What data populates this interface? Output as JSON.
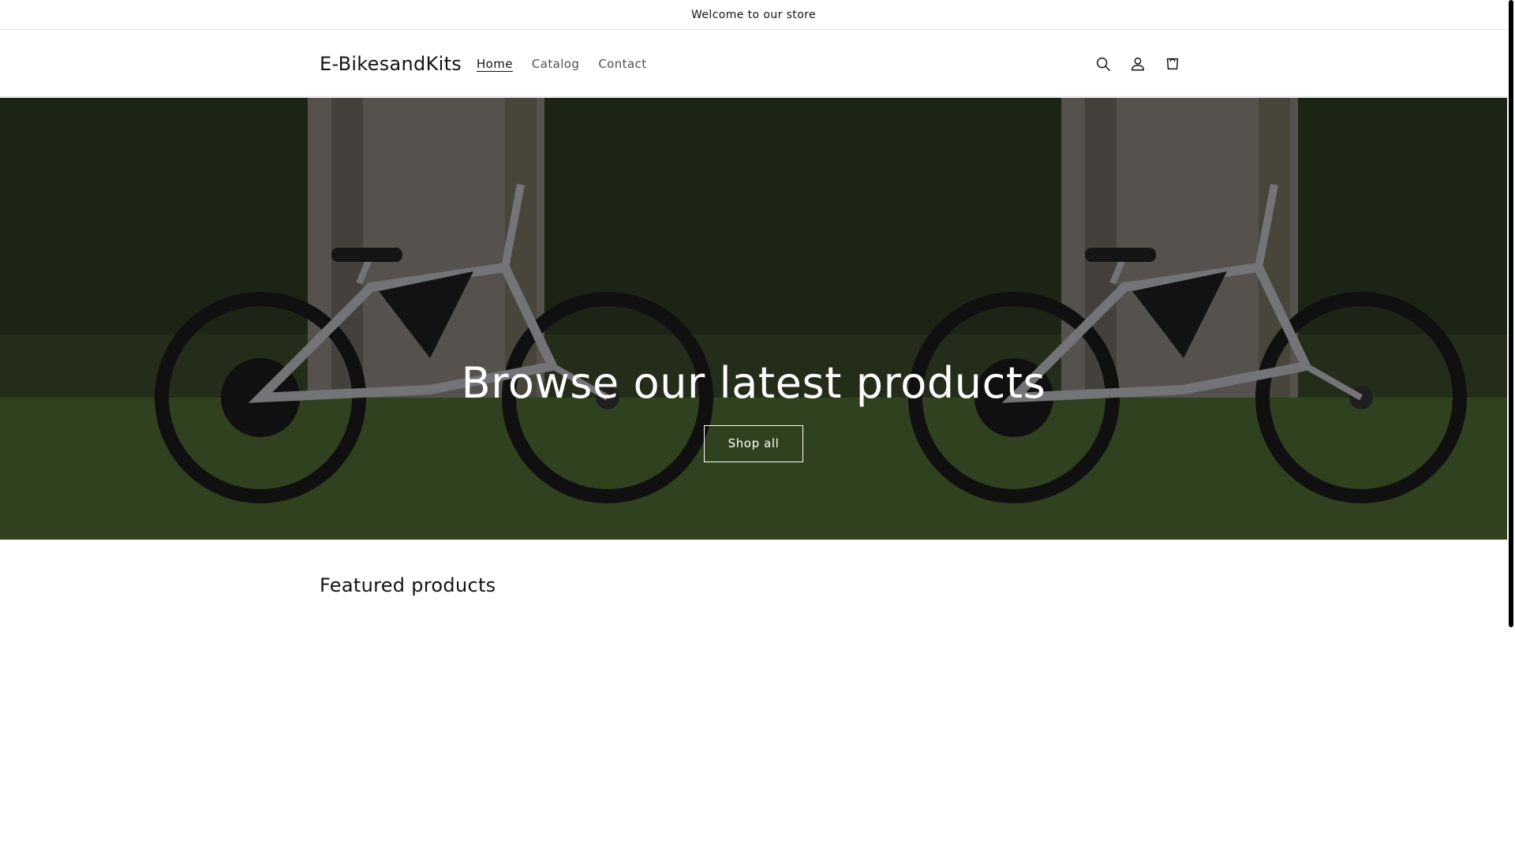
{
  "announcement": {
    "text": "Welcome to our store"
  },
  "header": {
    "logo": "E-BikesandKits",
    "nav": [
      {
        "label": "Home",
        "active": true
      },
      {
        "label": "Catalog",
        "active": false
      },
      {
        "label": "Contact",
        "active": false
      }
    ],
    "icons": [
      "search-icon",
      "account-icon",
      "cart-icon"
    ]
  },
  "hero": {
    "title": "Browse our latest products",
    "button_label": "Shop all",
    "overlay_color": "#000000"
  },
  "featured": {
    "title": "Featured products"
  }
}
